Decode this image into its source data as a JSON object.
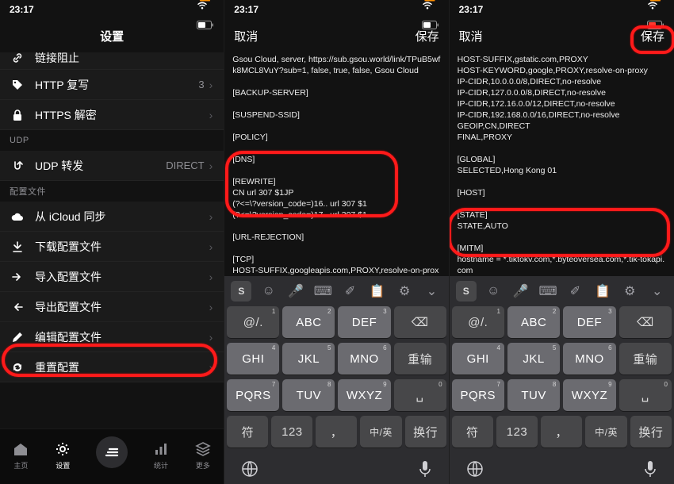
{
  "status": {
    "time": "23:17",
    "signal_label": "signal",
    "wifi_label": "wifi",
    "battery_label": "battery"
  },
  "screen1": {
    "title": "设置",
    "rows_top": [
      {
        "icon": "link",
        "label": "链接阻止"
      },
      {
        "icon": "tag",
        "label": "HTTP 复写",
        "badge": "3"
      },
      {
        "icon": "lock",
        "label": "HTTPS 解密"
      }
    ],
    "section_udp": "UDP",
    "row_udp": {
      "icon": "uturn",
      "label": "UDP 转发",
      "badge": "DIRECT"
    },
    "section_cfg": "配置文件",
    "rows_cfg": [
      {
        "icon": "cloud",
        "label": "从 iCloud 同步"
      },
      {
        "icon": "download",
        "label": "下载配置文件"
      },
      {
        "icon": "import",
        "label": "导入配置文件"
      },
      {
        "icon": "export",
        "label": "导出配置文件"
      },
      {
        "icon": "pencil",
        "label": "编辑配置文件"
      },
      {
        "icon": "refresh",
        "label": "重置配置"
      }
    ],
    "tabs": [
      {
        "icon": "home",
        "label": "主页"
      },
      {
        "icon": "gear",
        "label": "设置"
      },
      {
        "icon": "center",
        "label": ""
      },
      {
        "icon": "bars",
        "label": "统计"
      },
      {
        "icon": "stack",
        "label": "更多"
      }
    ]
  },
  "screen2": {
    "nav_left": "取消",
    "nav_right": "保存",
    "config": "Gsou Cloud, server, https://sub.gsou.world/link/TPuB5wfk8MCL8VuY?sub=1, false, true, false, Gsou Cloud\n\n[BACKUP-SERVER]\n\n[SUSPEND-SSID]\n\n[POLICY]\n\n[DNS]\n\n[REWRITE]\nCN url 307 $1JP\n(?<=\\?version_code=)16.. url 307 $1\n(?<=\\?version_code=)17.. url 307 $1\n\n[URL-REJECTION]\n\n[TCP]\nHOST-SUFFIX,googleapis.com,PROXY,resolve-on-proxy\nHOST-SUFFIX,instagram.com,PROXY,resolve-on-proxy"
  },
  "screen3": {
    "nav_left": "取消",
    "nav_right": "保存",
    "config": "HOST-SUFFIX,gstatic.com,PROXY\nHOST-KEYWORD,google,PROXY,resolve-on-proxy\nIP-CIDR,10.0.0.0/8,DIRECT,no-resolve\nIP-CIDR,127.0.0.0/8,DIRECT,no-resolve\nIP-CIDR,172.16.0.0/12,DIRECT,no-resolve\nIP-CIDR,192.168.0.0/16,DIRECT,no-resolve\nGEOIP,CN,DIRECT\nFINAL,PROXY\n\n[GLOBAL]\nSELECTED,Hong Kong 01\n\n[HOST]\n\n[STATE]\nSTATE,AUTO\n\n[MITM]\nhostname = *.tiktokv.com,*.byteoversea.com,*.tik-tokapi.com"
  },
  "keyboard": {
    "toolbar_first": "S",
    "row1": [
      {
        "sub": "1",
        "main": "@/.",
        "dark": true
      },
      {
        "sub": "2",
        "main": "ABC"
      },
      {
        "sub": "3",
        "main": "DEF"
      },
      {
        "main": "⌫",
        "dark": true
      }
    ],
    "row2": [
      {
        "sub": "4",
        "main": "GHI"
      },
      {
        "sub": "5",
        "main": "JKL"
      },
      {
        "sub": "6",
        "main": "MNO"
      },
      {
        "main": "重输",
        "dark": true
      }
    ],
    "row3": [
      {
        "sub": "7",
        "main": "PQRS"
      },
      {
        "sub": "8",
        "main": "TUV"
      },
      {
        "sub": "9",
        "main": "WXYZ"
      },
      {
        "sub": "0",
        "main": "␣",
        "dark": true
      }
    ],
    "row4": [
      {
        "main": "符",
        "dark": true
      },
      {
        "main": "123",
        "dark": true
      },
      {
        "main": "，",
        "dark": true
      },
      {
        "main": "中/英",
        "dark": true
      },
      {
        "main": "换行",
        "dark": true
      }
    ]
  }
}
